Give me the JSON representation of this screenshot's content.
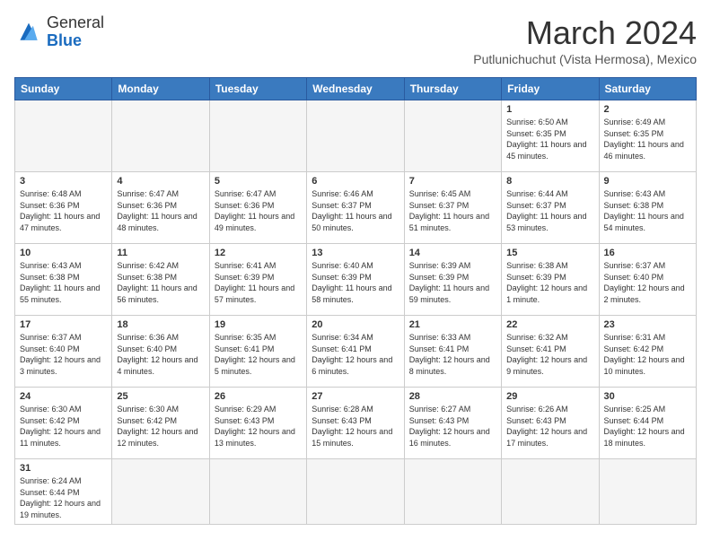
{
  "header": {
    "logo_general": "General",
    "logo_blue": "Blue",
    "month_title": "March 2024",
    "subtitle": "Putlunichuchut (Vista Hermosa), Mexico"
  },
  "days_of_week": [
    "Sunday",
    "Monday",
    "Tuesday",
    "Wednesday",
    "Thursday",
    "Friday",
    "Saturday"
  ],
  "weeks": [
    [
      {
        "day": "",
        "info": ""
      },
      {
        "day": "",
        "info": ""
      },
      {
        "day": "",
        "info": ""
      },
      {
        "day": "",
        "info": ""
      },
      {
        "day": "",
        "info": ""
      },
      {
        "day": "1",
        "info": "Sunrise: 6:50 AM\nSunset: 6:35 PM\nDaylight: 11 hours\nand 45 minutes."
      },
      {
        "day": "2",
        "info": "Sunrise: 6:49 AM\nSunset: 6:35 PM\nDaylight: 11 hours\nand 46 minutes."
      }
    ],
    [
      {
        "day": "3",
        "info": "Sunrise: 6:48 AM\nSunset: 6:36 PM\nDaylight: 11 hours\nand 47 minutes."
      },
      {
        "day": "4",
        "info": "Sunrise: 6:47 AM\nSunset: 6:36 PM\nDaylight: 11 hours\nand 48 minutes."
      },
      {
        "day": "5",
        "info": "Sunrise: 6:47 AM\nSunset: 6:36 PM\nDaylight: 11 hours\nand 49 minutes."
      },
      {
        "day": "6",
        "info": "Sunrise: 6:46 AM\nSunset: 6:37 PM\nDaylight: 11 hours\nand 50 minutes."
      },
      {
        "day": "7",
        "info": "Sunrise: 6:45 AM\nSunset: 6:37 PM\nDaylight: 11 hours\nand 51 minutes."
      },
      {
        "day": "8",
        "info": "Sunrise: 6:44 AM\nSunset: 6:37 PM\nDaylight: 11 hours\nand 53 minutes."
      },
      {
        "day": "9",
        "info": "Sunrise: 6:43 AM\nSunset: 6:38 PM\nDaylight: 11 hours\nand 54 minutes."
      }
    ],
    [
      {
        "day": "10",
        "info": "Sunrise: 6:43 AM\nSunset: 6:38 PM\nDaylight: 11 hours\nand 55 minutes."
      },
      {
        "day": "11",
        "info": "Sunrise: 6:42 AM\nSunset: 6:38 PM\nDaylight: 11 hours\nand 56 minutes."
      },
      {
        "day": "12",
        "info": "Sunrise: 6:41 AM\nSunset: 6:39 PM\nDaylight: 11 hours\nand 57 minutes."
      },
      {
        "day": "13",
        "info": "Sunrise: 6:40 AM\nSunset: 6:39 PM\nDaylight: 11 hours\nand 58 minutes."
      },
      {
        "day": "14",
        "info": "Sunrise: 6:39 AM\nSunset: 6:39 PM\nDaylight: 11 hours\nand 59 minutes."
      },
      {
        "day": "15",
        "info": "Sunrise: 6:38 AM\nSunset: 6:39 PM\nDaylight: 12 hours\nand 1 minute."
      },
      {
        "day": "16",
        "info": "Sunrise: 6:37 AM\nSunset: 6:40 PM\nDaylight: 12 hours\nand 2 minutes."
      }
    ],
    [
      {
        "day": "17",
        "info": "Sunrise: 6:37 AM\nSunset: 6:40 PM\nDaylight: 12 hours\nand 3 minutes."
      },
      {
        "day": "18",
        "info": "Sunrise: 6:36 AM\nSunset: 6:40 PM\nDaylight: 12 hours\nand 4 minutes."
      },
      {
        "day": "19",
        "info": "Sunrise: 6:35 AM\nSunset: 6:41 PM\nDaylight: 12 hours\nand 5 minutes."
      },
      {
        "day": "20",
        "info": "Sunrise: 6:34 AM\nSunset: 6:41 PM\nDaylight: 12 hours\nand 6 minutes."
      },
      {
        "day": "21",
        "info": "Sunrise: 6:33 AM\nSunset: 6:41 PM\nDaylight: 12 hours\nand 8 minutes."
      },
      {
        "day": "22",
        "info": "Sunrise: 6:32 AM\nSunset: 6:41 PM\nDaylight: 12 hours\nand 9 minutes."
      },
      {
        "day": "23",
        "info": "Sunrise: 6:31 AM\nSunset: 6:42 PM\nDaylight: 12 hours\nand 10 minutes."
      }
    ],
    [
      {
        "day": "24",
        "info": "Sunrise: 6:30 AM\nSunset: 6:42 PM\nDaylight: 12 hours\nand 11 minutes."
      },
      {
        "day": "25",
        "info": "Sunrise: 6:30 AM\nSunset: 6:42 PM\nDaylight: 12 hours\nand 12 minutes."
      },
      {
        "day": "26",
        "info": "Sunrise: 6:29 AM\nSunset: 6:43 PM\nDaylight: 12 hours\nand 13 minutes."
      },
      {
        "day": "27",
        "info": "Sunrise: 6:28 AM\nSunset: 6:43 PM\nDaylight: 12 hours\nand 15 minutes."
      },
      {
        "day": "28",
        "info": "Sunrise: 6:27 AM\nSunset: 6:43 PM\nDaylight: 12 hours\nand 16 minutes."
      },
      {
        "day": "29",
        "info": "Sunrise: 6:26 AM\nSunset: 6:43 PM\nDaylight: 12 hours\nand 17 minutes."
      },
      {
        "day": "30",
        "info": "Sunrise: 6:25 AM\nSunset: 6:44 PM\nDaylight: 12 hours\nand 18 minutes."
      }
    ],
    [
      {
        "day": "31",
        "info": "Sunrise: 6:24 AM\nSunset: 6:44 PM\nDaylight: 12 hours\nand 19 minutes."
      },
      {
        "day": "",
        "info": ""
      },
      {
        "day": "",
        "info": ""
      },
      {
        "day": "",
        "info": ""
      },
      {
        "day": "",
        "info": ""
      },
      {
        "day": "",
        "info": ""
      },
      {
        "day": "",
        "info": ""
      }
    ]
  ]
}
